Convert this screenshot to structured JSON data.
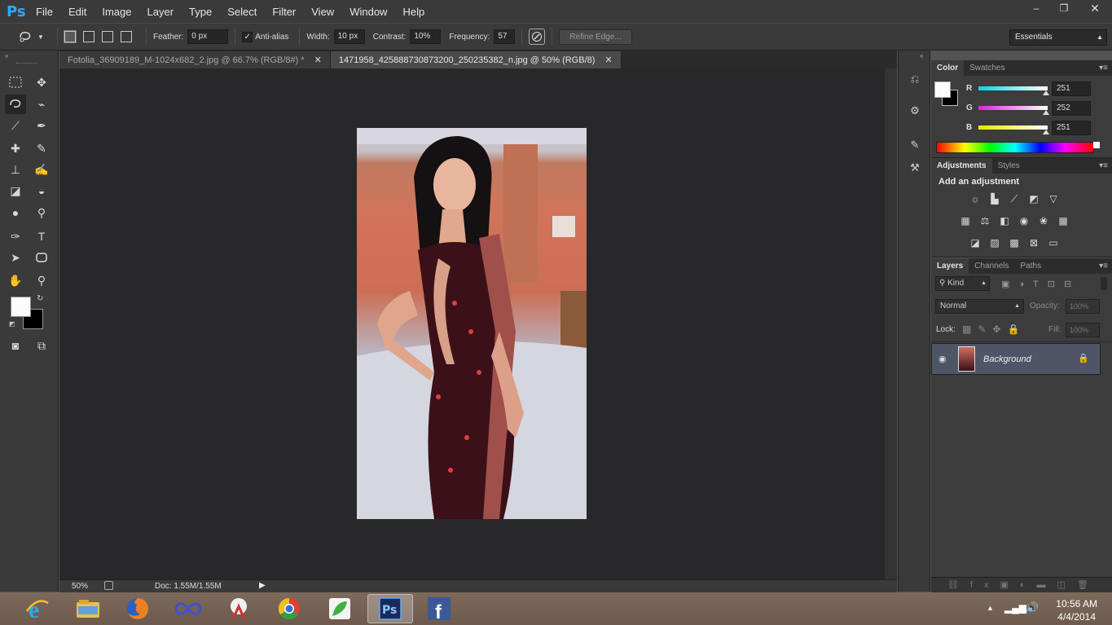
{
  "app": {
    "logo": "Ps"
  },
  "menu": [
    "File",
    "Edit",
    "Image",
    "Layer",
    "Type",
    "Select",
    "Filter",
    "View",
    "Window",
    "Help"
  ],
  "window_controls": {
    "minimize": "–",
    "restore": "❐",
    "close": "✕"
  },
  "options": {
    "feather_label": "Feather:",
    "feather_value": "0 px",
    "antialias_label": "Anti-alias",
    "antialias_checked": "✓",
    "width_label": "Width:",
    "width_value": "10 px",
    "contrast_label": "Contrast:",
    "contrast_value": "10%",
    "frequency_label": "Frequency:",
    "frequency_value": "57",
    "refine_edge": "Refine Edge...",
    "workspace": "Essentials"
  },
  "tabs": [
    {
      "title": "Fotolia_36909189_M-1024x682_2.jpg @ 66.7% (RGB/8#) *",
      "close": "✕"
    },
    {
      "title": "1471958_425888730873200_250235382_n.jpg @ 50% (RGB/8)",
      "close": "✕"
    }
  ],
  "status": {
    "zoom": "50%",
    "doc": "Doc: 1.55M/1.55M"
  },
  "color_panel": {
    "tabs": [
      "Color",
      "Swatches"
    ],
    "channels": [
      {
        "label": "R",
        "value": "251",
        "color": "#00e5ff"
      },
      {
        "label": "G",
        "value": "252",
        "color": "#e533e5"
      },
      {
        "label": "B",
        "value": "251",
        "color": "#e8e800"
      }
    ],
    "foreground": "#fbfcfb",
    "background": "#000000"
  },
  "adjustments_panel": {
    "tabs": [
      "Adjustments",
      "Styles"
    ],
    "heading": "Add an adjustment"
  },
  "layers_panel": {
    "tabs": [
      "Layers",
      "Channels",
      "Paths"
    ],
    "kind": "Kind",
    "blend_mode": "Normal",
    "opacity_label": "Opacity:",
    "opacity_value": "100%",
    "lock_label": "Lock:",
    "fill_label": "Fill:",
    "fill_value": "100%",
    "layer_name": "Background"
  },
  "taskbar": {
    "time": "10:56 AM",
    "date": "4/4/2014"
  }
}
